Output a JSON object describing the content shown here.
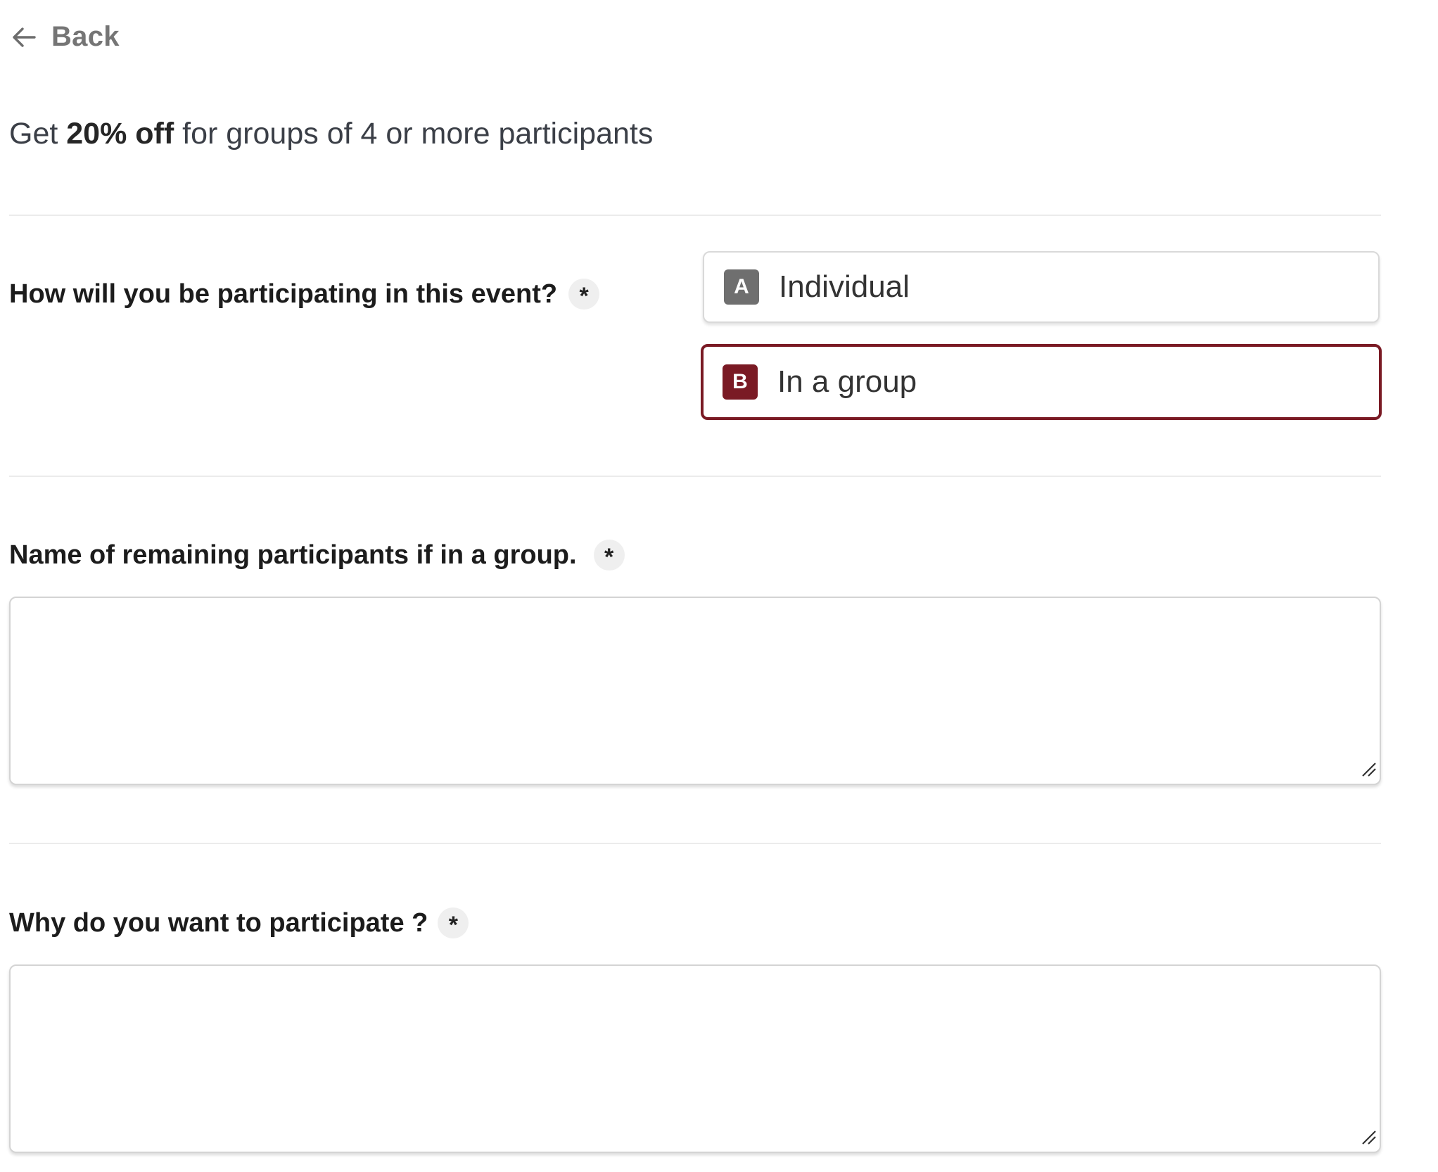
{
  "back": {
    "label": "Back"
  },
  "promo": {
    "prefix": "Get",
    "highlight": "20% off",
    "suffix": "for groups of 4 or more participants"
  },
  "questions": [
    {
      "label": "How will you be participating in this event?",
      "required_mark": "*",
      "options": [
        {
          "key": "A",
          "label": "Individual",
          "selected": false
        },
        {
          "key": "B",
          "label": "In a group",
          "selected": true
        }
      ]
    },
    {
      "label": "Name of remaining participants if in a group.",
      "required_mark": "*",
      "value": "",
      "placeholder": ""
    },
    {
      "label": "Why do you want to participate ?",
      "required_mark": "*",
      "value": "",
      "placeholder": ""
    }
  ],
  "colors": {
    "accent": "#7a1a24",
    "key_default": "#6f6f6f",
    "divider": "#ebebeb",
    "required_badge_bg": "#efefef"
  },
  "icons": {
    "back": "arrow-left-icon",
    "resize": "resize-grip-icon"
  }
}
